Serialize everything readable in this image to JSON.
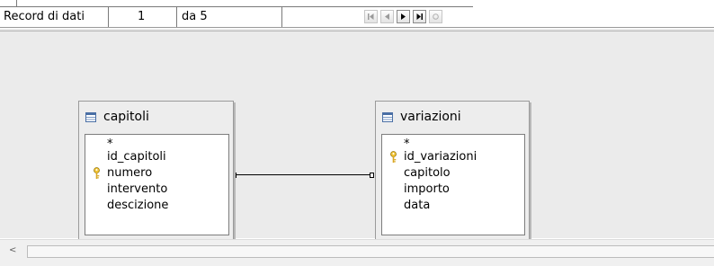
{
  "nav": {
    "record_label": "Record di dati",
    "current_record": "1",
    "of_total": "da 5"
  },
  "tables": [
    {
      "name": "capitoli",
      "fields": [
        {
          "name": "*",
          "key": false
        },
        {
          "name": "id_capitoli",
          "key": false
        },
        {
          "name": "numero",
          "key": true
        },
        {
          "name": "intervento",
          "key": false
        },
        {
          "name": "descizione",
          "key": false
        }
      ]
    },
    {
      "name": "variazioni",
      "fields": [
        {
          "name": "*",
          "key": false
        },
        {
          "name": "id_variazioni",
          "key": true
        },
        {
          "name": "capitolo",
          "key": false
        },
        {
          "name": "importo",
          "key": false
        },
        {
          "name": "data",
          "key": false
        }
      ]
    }
  ],
  "scrollbar": {
    "left_arrow": "<"
  }
}
